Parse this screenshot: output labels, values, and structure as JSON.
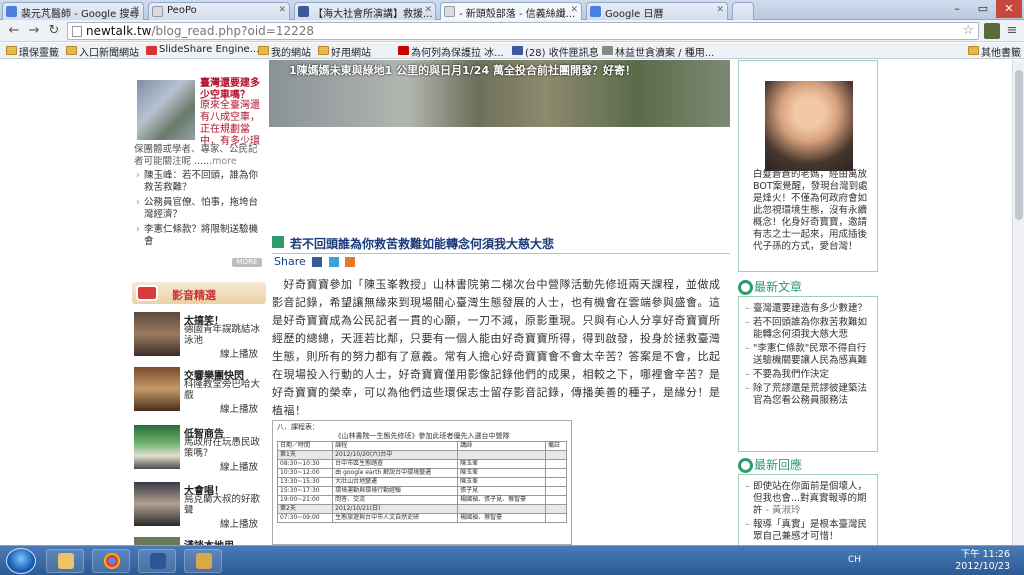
{
  "tabs": [
    {
      "label": "裴元芃醫師 - Google 搜尋",
      "color": "#4a7fe0"
    },
    {
      "label": "PeoPo",
      "color": "#d9dde3"
    },
    {
      "label": "【海大社會所演講】救援...",
      "color": "#3b5998"
    },
    {
      "label": "- 新頭殼部落 - 信義絲纖...",
      "color": "#d9dde3"
    },
    {
      "label": "Google 日曆",
      "color": "#4a7fe0"
    }
  ],
  "url": {
    "host": "newtalk.tw",
    "path": "/blog_read.php?oid=12228"
  },
  "bookmarks": [
    {
      "label": "環保靈籤"
    },
    {
      "label": "入口新聞網站"
    },
    {
      "label": "SlideShare Engine..."
    },
    {
      "label": "我的網站"
    },
    {
      "label": "好用網站"
    },
    {
      "label": "為何列為保護拉 冰..."
    },
    {
      "label": "(28) 收件匣訊息"
    },
    {
      "label": "林益世貪瀆案 / 種用..."
    },
    {
      "label": "其他書籤"
    }
  ],
  "hero": {
    "caption": "1陳媽媽未東與綠地1 公里的與日月1/24 萬全投合前社團開發？好寄！"
  },
  "left": {
    "feature_title": "臺灣還要建多少空車嗎？",
    "feature_text": "原來全臺灣還有八成空車，正在規劃當中，有多少環",
    "feature_text2": "保團體或學者、專家、公民記者可能關注呢 ......",
    "more_link": "more",
    "list": [
      "陳玉峰：若不回頭，誰為你救苦救難？",
      "公務員官僚、怕事，拖垮台灣經濟？",
      "李憲仁條款？將限制送驗機會"
    ],
    "more_button": "MORE",
    "video_header": "影音精選",
    "videos": [
      {
        "title": "太搞笑！",
        "desc": "德國青年誤跳結冰泳池",
        "play": "線上播放"
      },
      {
        "title": "交響樂團快閃",
        "desc": "科隆教堂旁巴哈大戲",
        "play": "線上播放"
      },
      {
        "title": "低智商告",
        "desc": "馬政府在玩愚民政策嗎？",
        "play": "線上播放"
      },
      {
        "title": "大會唱！",
        "desc": "烏克蘭大叔的好歌聲",
        "play": "線上播放"
      },
      {
        "title": "淺談本地用..."
      }
    ]
  },
  "article": {
    "title": "若不回頭誰為你救苦救難如能轉念何須我大慈大悲",
    "share_label": "Share",
    "body": "　好奇寶寶參加「陳玉峯教授」山林書院第二梯次台中營隊活動先修班兩天課程，並做成影音記錄，希望讓無緣來到現場關心臺灣生態發展的人士，也有機會在雲端參與盛會。這是好奇寶寶成為公民記者一貫的心願，一刀不減，原影重現。只與有心人分享好奇寶寶所經歷的總總，天涯若比鄰，只要有一個人能由好奇寶寶所得，得到啟發，投身於拯救臺灣生態，則所有的努力都有了意義。常有人擔心好奇寶寶會不會太辛苦？答案是不會，比起在現場投入行動的人士，好奇寶寶僅用影像記錄他們的成果，相較之下，哪裡會辛苦？是好奇寶寶的榮幸，可以為他們這些環保志士留存影音記錄，傳播美善的種子，是緣分！是植福！",
    "schedule": {
      "title": "八．課程表：",
      "subtitle": "《山林書院一生態先修班》參加此班者優先入選台中營隊",
      "headers": [
        "日期／時間",
        "課程",
        "講師",
        "備註"
      ],
      "rows": [
        [
          "第1天",
          "2012/10/20(六)台中",
          "",
          ""
        ],
        [
          "08:30~10:30",
          "台中市區生態踏查",
          "陳玉峯",
          ""
        ],
        [
          "10:30~12:00",
          "由 google earth 解說台中環境變遷",
          "陳玉峯",
          ""
        ],
        [
          "13:30~15:30",
          "大肚山台地變遷",
          "陳玉峯",
          ""
        ],
        [
          "15:30~17:30",
          "環境運動與環境行動經驗",
          "張子見",
          ""
        ],
        [
          "19:00~21:00",
          "問答．交流",
          "楊國禎、張子見、蔡智豪",
          ""
        ],
        [
          "第2天",
          "2012/10/21(日)",
          "",
          ""
        ],
        [
          "07:30~09:00",
          "生態旅遊與台中市人文自然史研",
          "楊國禎、蔡智豪",
          ""
        ]
      ]
    }
  },
  "right": {
    "bio": "白髮蒼蒼的老媽，經由萬放BOT案覺醒，發現台灣到處是烽火！不僅為何政府會如此忽視環境生態，沒有永續概念！化身好奇寶寶，邀請有志之士一起來，用成插後代子孫的方式，愛台灣！",
    "latest_articles_title": "最新文章",
    "latest_articles": [
      "臺灣還要建造有多少數建？",
      "若不回頭誰為你救苦救難如能轉念何須我大慈大悲",
      "\"李憲仁條款\"民眾不得自行送驗機關要讓人民為感真難",
      "不要為我們作決定",
      "除了荒謬還是荒謬彼建築法官為您看公務員服務法"
    ],
    "latest_replies_title": "最新回應",
    "latest_replies": [
      {
        "text": "即使站在你面前是個壞人，但我也會...對真實報導的期許",
        "src": "- 黃淑玲"
      },
      {
        "text": "報導「真實」是根本臺灣民眾自己兼感才可惜！",
        "src": ""
      }
    ]
  },
  "taskbar": {
    "lang": "CH",
    "time": "下午 11:26",
    "date": "2012/10/23"
  }
}
